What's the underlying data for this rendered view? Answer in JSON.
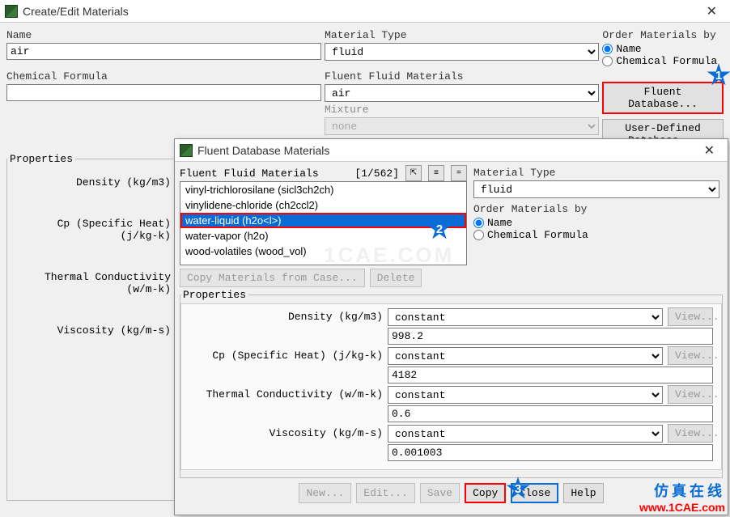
{
  "window": {
    "title": "Create/Edit Materials"
  },
  "main": {
    "name_label": "Name",
    "name_value": "air",
    "formula_label": "Chemical Formula",
    "formula_value": "",
    "mat_type_label": "Material Type",
    "mat_type_value": "fluid",
    "fluent_fluid_label": "Fluent Fluid Materials",
    "fluent_fluid_value": "air",
    "mixture_label": "Mixture",
    "mixture_value": "none",
    "order_label": "Order Materials by",
    "order_name": "Name",
    "order_formula": "Chemical Formula",
    "fluent_db_btn": "Fluent Database...",
    "user_db_btn": "User-Defined Database...",
    "props_legend": "Properties",
    "props": [
      "Density (kg/m3)",
      "Cp (Specific Heat) (j/kg-k)",
      "Thermal Conductivity (w/m-k)",
      "Viscosity (kg/m-s)"
    ]
  },
  "dialog": {
    "title": "Fluent Database Materials",
    "list_label": "Fluent Fluid Materials",
    "list_count": "[1/562]",
    "items": [
      {
        "label": "vinyl-trichlorosilane (sicl3ch2ch)",
        "selected": false
      },
      {
        "label": "vinylidene-chloride (ch2ccl2)",
        "selected": false
      },
      {
        "label": "water-liquid (h2o<l>)",
        "selected": true
      },
      {
        "label": "water-vapor (h2o)",
        "selected": false
      },
      {
        "label": "wood-volatiles (wood_vol)",
        "selected": false
      }
    ],
    "copy_case_btn": "Copy Materials from Case...",
    "delete_btn": "Delete",
    "mat_type_label": "Material Type",
    "mat_type_value": "fluid",
    "order_label": "Order Materials by",
    "order_name": "Name",
    "order_formula": "Chemical Formula",
    "props_legend": "Properties",
    "view_btn": "View...",
    "properties": [
      {
        "label": "Density (kg/m3)",
        "type": "constant",
        "value": "998.2"
      },
      {
        "label": "Cp (Specific Heat) (j/kg-k)",
        "type": "constant",
        "value": "4182"
      },
      {
        "label": "Thermal Conductivity (w/m-k)",
        "type": "constant",
        "value": "0.6"
      },
      {
        "label": "Viscosity (kg/m-s)",
        "type": "constant",
        "value": "0.001003"
      }
    ],
    "buttons": {
      "new": "New...",
      "edit": "Edit...",
      "save": "Save",
      "copy": "Copy",
      "close": "Close",
      "help": "Help"
    }
  },
  "steps": {
    "s1": "1",
    "s2": "2",
    "s3": "3"
  },
  "watermark": {
    "cn": "仿真在线",
    "url": "www.1CAE.com"
  }
}
